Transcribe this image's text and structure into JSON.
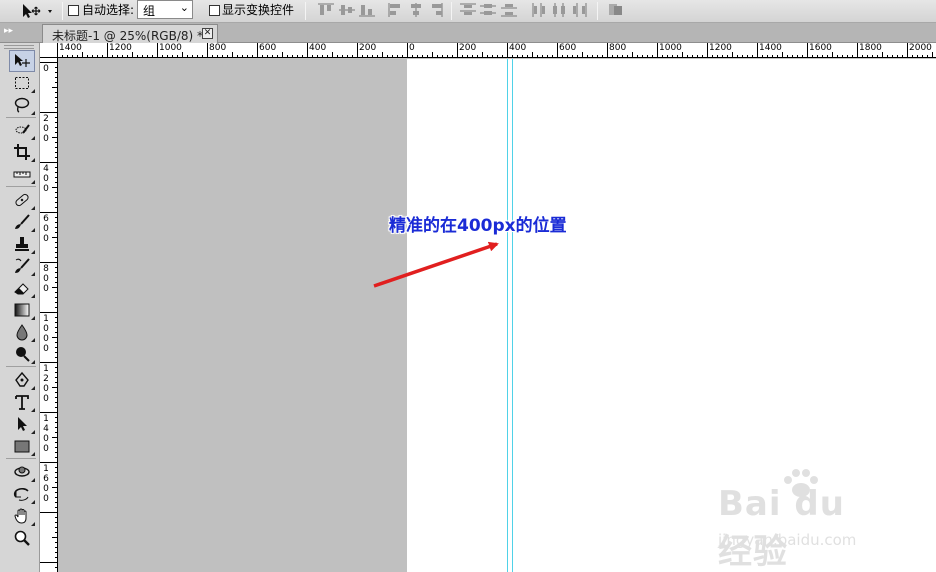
{
  "options_bar": {
    "auto_select_label": "自动选择:",
    "auto_select_value": "组",
    "show_transform_label": "显示变换控件",
    "auto_select_checked": false,
    "show_transform_checked": false
  },
  "document_tab": {
    "title": "未标题-1 @ 25%(RGB/8) *",
    "close_glyph": "✕"
  },
  "rulers": {
    "horizontal_labels": [
      "1400",
      "1200",
      "1000",
      "800",
      "600",
      "400",
      "200",
      "0",
      "200",
      "400",
      "600",
      "800",
      "1000",
      "1200",
      "1400",
      "1600",
      "1800",
      "2000"
    ],
    "vertical_labels": [
      "0",
      "200",
      "400",
      "600",
      "800",
      "1000",
      "1200",
      "1400",
      "1600"
    ]
  },
  "annotation": {
    "prefix": "精准的在",
    "highlight": "400px",
    "suffix": "的位置",
    "color": "#1a2bd6",
    "arrow_color": "#e11f1f"
  },
  "guide_color": "#4fd2e8",
  "watermark": {
    "brand": "Bai du 经验",
    "url": "jingyan.baidu.com"
  },
  "tools": [
    {
      "name": "move-icon"
    },
    {
      "name": "marquee-icon"
    },
    {
      "name": "lasso-icon"
    },
    {
      "name": "quick-select-icon"
    },
    {
      "name": "crop-icon"
    },
    {
      "name": "ruler-icon"
    },
    {
      "name": "healing-brush-icon"
    },
    {
      "name": "brush-icon"
    },
    {
      "name": "clone-stamp-icon"
    },
    {
      "name": "history-brush-icon"
    },
    {
      "name": "eraser-icon"
    },
    {
      "name": "gradient-icon"
    },
    {
      "name": "blur-icon"
    },
    {
      "name": "dodge-icon"
    },
    {
      "name": "pen-icon"
    },
    {
      "name": "type-icon"
    },
    {
      "name": "path-select-icon"
    },
    {
      "name": "shape-icon"
    },
    {
      "name": "rotate-3d-icon"
    },
    {
      "name": "orbit-3d-icon"
    },
    {
      "name": "hand-icon"
    },
    {
      "name": "zoom-icon"
    }
  ]
}
